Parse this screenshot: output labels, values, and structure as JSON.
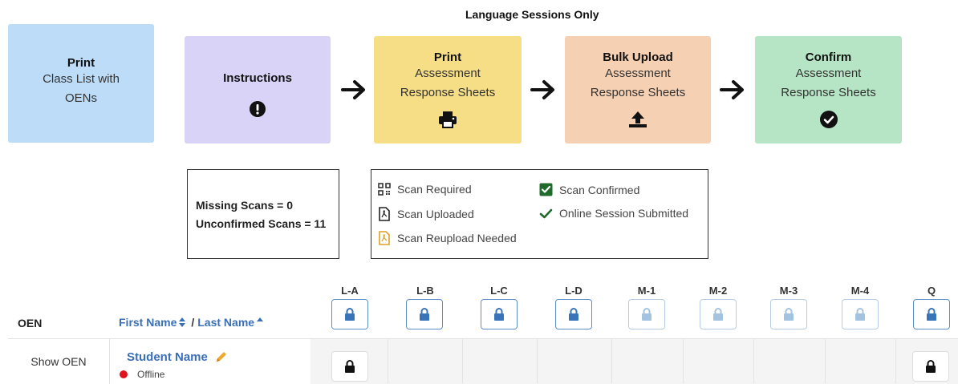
{
  "header": {
    "language_sessions_only": "Language Sessions Only"
  },
  "workflow": {
    "print_class": {
      "title": "Print",
      "line1": "Class List with",
      "line2": "OENs",
      "color": "#bcdcf7"
    },
    "instructions": {
      "title": "Instructions",
      "icon": "exclamation-circle-icon",
      "color": "#d9d4f7"
    },
    "print_sheets": {
      "title": "Print",
      "line1": "Assessment",
      "line2": "Response Sheets",
      "icon": "printer-icon",
      "color": "#f6de86"
    },
    "bulk_upload": {
      "title": "Bulk Upload",
      "line1": "Assessment",
      "line2": "Response Sheets",
      "icon": "upload-icon",
      "color": "#f6d0b2"
    },
    "confirm": {
      "title": "Confirm",
      "line1": "Assessment",
      "line2": "Response Sheets",
      "icon": "check-circle-icon",
      "color": "#b5e5c4"
    }
  },
  "scans": {
    "missing": "Missing Scans = 0",
    "unconfirmed": "Unconfirmed Scans = 11"
  },
  "legend": {
    "scan_required": "Scan Required",
    "scan_uploaded": "Scan Uploaded",
    "scan_reupload": "Scan Reupload Needed",
    "scan_confirmed": "Scan Confirmed",
    "online_submitted": "Online Session Submitted"
  },
  "table": {
    "oen_header": "OEN",
    "first_name": "First Name",
    "separator": "/",
    "last_name": "Last Name",
    "columns": [
      "L-A",
      "L-B",
      "L-C",
      "L-D",
      "M-1",
      "M-2",
      "M-3",
      "M-4",
      "Q"
    ],
    "row": {
      "show_oen": "Show OEN",
      "student_name": "Student Name",
      "status": "Offline",
      "status_color": "#e0141e"
    }
  },
  "colors": {
    "accent": "#3a6fb8",
    "lock": "#3a74b8",
    "lock_faded": "#a3c3e0"
  }
}
